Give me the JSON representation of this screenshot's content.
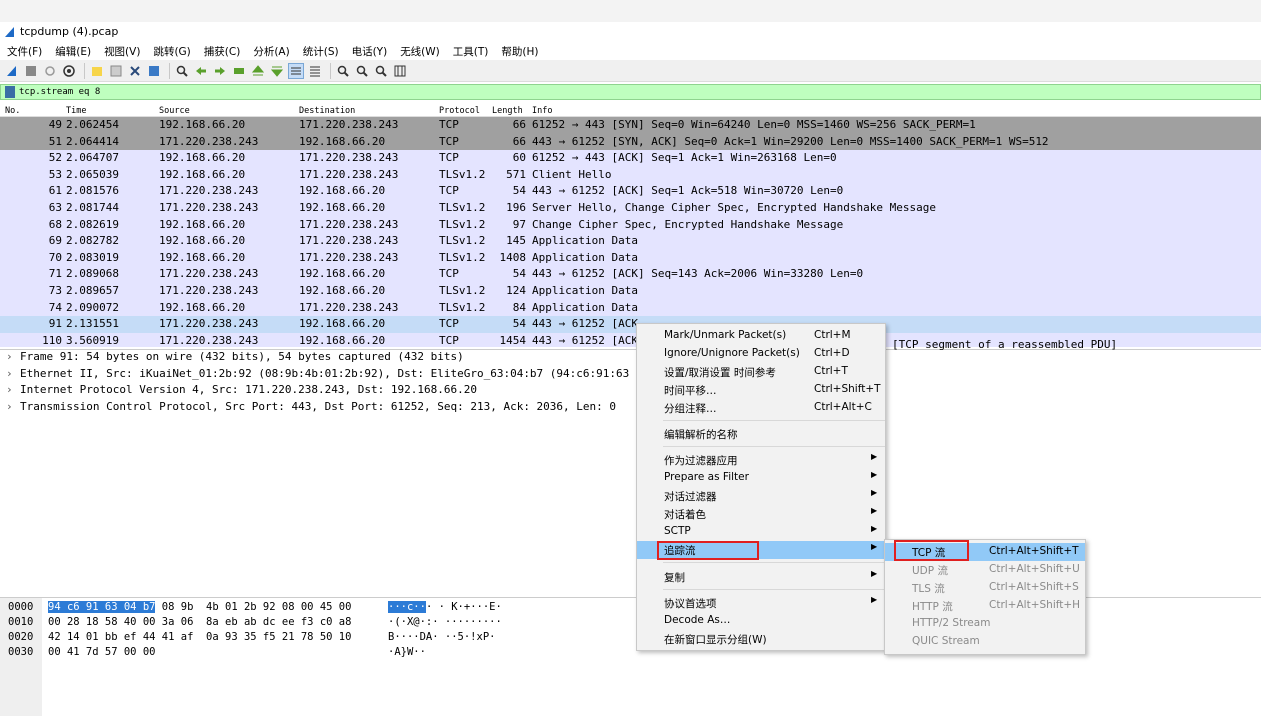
{
  "window": {
    "title": "tcpdump (4).pcap"
  },
  "menu": [
    "文件(F)",
    "编辑(E)",
    "视图(V)",
    "跳转(G)",
    "捕获(C)",
    "分析(A)",
    "统计(S)",
    "电话(Y)",
    "无线(W)",
    "工具(T)",
    "帮助(H)"
  ],
  "filter": {
    "value": "tcp.stream eq 8"
  },
  "columns": {
    "no": "No.",
    "time": "Time",
    "source": "Source",
    "destination": "Destination",
    "protocol": "Protocol",
    "length": "Length",
    "info": "Info"
  },
  "packets": [
    {
      "no": "49",
      "time": "2.062454",
      "src": "192.168.66.20",
      "dst": "171.220.238.243",
      "proto": "TCP",
      "len": "66",
      "info": "61252 → 443 [SYN] Seq=0 Win=64240 Len=0 MSS=1460 WS=256 SACK_PERM=1",
      "style": "gray"
    },
    {
      "no": "51",
      "time": "2.064414",
      "src": "171.220.238.243",
      "dst": "192.168.66.20",
      "proto": "TCP",
      "len": "66",
      "info": "443 → 61252 [SYN, ACK] Seq=0 Ack=1 Win=29200 Len=0 MSS=1400 SACK_PERM=1 WS=512",
      "style": "gray"
    },
    {
      "no": "52",
      "time": "2.064707",
      "src": "192.168.66.20",
      "dst": "171.220.238.243",
      "proto": "TCP",
      "len": "60",
      "info": "61252 → 443 [ACK] Seq=1 Ack=1 Win=263168 Len=0",
      "style": "blue"
    },
    {
      "no": "53",
      "time": "2.065039",
      "src": "192.168.66.20",
      "dst": "171.220.238.243",
      "proto": "TLSv1.2",
      "len": "571",
      "info": "Client Hello",
      "style": "blue"
    },
    {
      "no": "61",
      "time": "2.081576",
      "src": "171.220.238.243",
      "dst": "192.168.66.20",
      "proto": "TCP",
      "len": "54",
      "info": "443 → 61252 [ACK] Seq=1 Ack=518 Win=30720 Len=0",
      "style": "blue"
    },
    {
      "no": "63",
      "time": "2.081744",
      "src": "171.220.238.243",
      "dst": "192.168.66.20",
      "proto": "TLSv1.2",
      "len": "196",
      "info": "Server Hello, Change Cipher Spec, Encrypted Handshake Message",
      "style": "blue"
    },
    {
      "no": "68",
      "time": "2.082619",
      "src": "192.168.66.20",
      "dst": "171.220.238.243",
      "proto": "TLSv1.2",
      "len": "97",
      "info": "Change Cipher Spec, Encrypted Handshake Message",
      "style": "blue"
    },
    {
      "no": "69",
      "time": "2.082782",
      "src": "192.168.66.20",
      "dst": "171.220.238.243",
      "proto": "TLSv1.2",
      "len": "145",
      "info": "Application Data",
      "style": "blue"
    },
    {
      "no": "70",
      "time": "2.083019",
      "src": "192.168.66.20",
      "dst": "171.220.238.243",
      "proto": "TLSv1.2",
      "len": "1408",
      "info": "Application Data",
      "style": "blue"
    },
    {
      "no": "71",
      "time": "2.089068",
      "src": "171.220.238.243",
      "dst": "192.168.66.20",
      "proto": "TCP",
      "len": "54",
      "info": "443 → 61252 [ACK] Seq=143 Ack=2006 Win=33280 Len=0",
      "style": "blue"
    },
    {
      "no": "73",
      "time": "2.089657",
      "src": "171.220.238.243",
      "dst": "192.168.66.20",
      "proto": "TLSv1.2",
      "len": "124",
      "info": "Application Data",
      "style": "blue"
    },
    {
      "no": "74",
      "time": "2.090072",
      "src": "192.168.66.20",
      "dst": "171.220.238.243",
      "proto": "TLSv1.2",
      "len": "84",
      "info": "Application Data",
      "style": "blue"
    },
    {
      "no": "91",
      "time": "2.131551",
      "src": "171.220.238.243",
      "dst": "192.168.66.20",
      "proto": "TCP",
      "len": "54",
      "info": "443 → 61252 [ACK",
      "style": "selected"
    },
    {
      "no": "110",
      "time": "3.560919",
      "src": "171.220.238.243",
      "dst": "192.168.66.20",
      "proto": "TCP",
      "len": "1454",
      "info": "443 → 61252 [ACK",
      "style": "blue"
    }
  ],
  "packet_info_tail": "[TCP segment of a reassembled PDU]",
  "details": [
    "Frame 91: 54 bytes on wire (432 bits), 54 bytes captured (432 bits)",
    "Ethernet II, Src: iKuaiNet_01:2b:92 (08:9b:4b:01:2b:92), Dst: EliteGro_63:04:b7 (94:c6:91:63",
    "Internet Protocol Version 4, Src: 171.220.238.243, Dst: 192.168.66.20",
    "Transmission Control Protocol, Src Port: 443, Dst Port: 61252, Seq: 213, Ack: 2036, Len: 0"
  ],
  "hex": {
    "offsets": [
      "0000",
      "0010",
      "0020",
      "0030"
    ],
    "row0_hl": "94 c6 91 63 04 b7",
    "row0_rest": " 08 9b  4b 01 2b 92 08 00 45 00",
    "rows": [
      "00 28 18 58 40 00 3a 06  8a eb ab dc ee f3 c0 a8",
      "42 14 01 bb ef 44 41 af  0a 93 35 f5 21 78 50 10",
      "00 41 7d 57 00 00"
    ],
    "ascii0_hl": "···c··",
    "ascii0_rest": "· · K·+···E·",
    "ascii": [
      "·(·X@·:· ·········",
      "B····DA· ··5·!xP·",
      "·A}W··"
    ]
  },
  "context_menu": {
    "items": [
      {
        "label": "Mark/Unmark Packet(s)",
        "shortcut": "Ctrl+M"
      },
      {
        "label": "Ignore/Unignore Packet(s)",
        "shortcut": "Ctrl+D"
      },
      {
        "label": "设置/取消设置 时间参考",
        "shortcut": "Ctrl+T"
      },
      {
        "label": "时间平移…",
        "shortcut": "Ctrl+Shift+T"
      },
      {
        "label": "分组注释…",
        "shortcut": "Ctrl+Alt+C"
      },
      {
        "label": "编辑解析的名称",
        "shortcut": ""
      },
      {
        "label": "作为过滤器应用",
        "shortcut": ""
      },
      {
        "label": "Prepare as Filter",
        "shortcut": ""
      },
      {
        "label": "对话过滤器",
        "shortcut": ""
      },
      {
        "label": "对话着色",
        "shortcut": ""
      },
      {
        "label": "SCTP",
        "shortcut": ""
      },
      {
        "label": "追踪流",
        "shortcut": ""
      },
      {
        "label": "复制",
        "shortcut": ""
      },
      {
        "label": "协议首选项",
        "shortcut": ""
      },
      {
        "label": "Decode As…",
        "shortcut": ""
      },
      {
        "label": "在新窗口显示分组(W)",
        "shortcut": ""
      }
    ]
  },
  "submenu": {
    "items": [
      {
        "label": "TCP 流",
        "shortcut": "Ctrl+Alt+Shift+T"
      },
      {
        "label": "UDP 流",
        "shortcut": "Ctrl+Alt+Shift+U"
      },
      {
        "label": "TLS 流",
        "shortcut": "Ctrl+Alt+Shift+S"
      },
      {
        "label": "HTTP 流",
        "shortcut": "Ctrl+Alt+Shift+H"
      },
      {
        "label": "HTTP/2 Stream",
        "shortcut": ""
      },
      {
        "label": "QUIC Stream",
        "shortcut": ""
      }
    ]
  },
  "colors": {
    "selected_row": "#c5dcf7",
    "gray_row": "#a0a0a0",
    "blue_row": "#e4e4ff",
    "filter_bg": "#bfffbf",
    "highlight": "#91c9f7",
    "annotation": "#e02020"
  }
}
